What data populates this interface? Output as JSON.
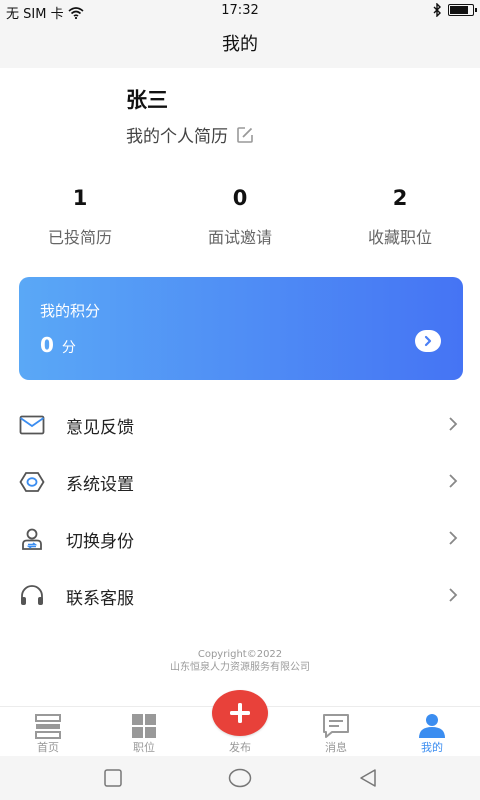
{
  "status_bar": {
    "carrier": "无 SIM 卡",
    "time": "17:32",
    "icons": [
      "wifi-icon",
      "bluetooth-icon",
      "battery-icon"
    ],
    "battery_level": 0.85
  },
  "header": {
    "title": "我的"
  },
  "profile": {
    "name": "张三",
    "resume_label": "我的个人简历",
    "resume_icon": "edit-icon"
  },
  "stats": [
    {
      "value": "1",
      "label": "已投简历"
    },
    {
      "value": "0",
      "label": "面试邀请"
    },
    {
      "value": "2",
      "label": "收藏职位"
    }
  ],
  "points": {
    "title": "我的积分",
    "value": "0",
    "unit": "分",
    "arrow_icon": "chevron-right-circle-icon"
  },
  "menu": [
    {
      "label": "意见反馈",
      "icon": "mail-icon"
    },
    {
      "label": "系统设置",
      "icon": "settings-hex-icon"
    },
    {
      "label": "切换身份",
      "icon": "user-switch-icon"
    },
    {
      "label": "联系客服",
      "icon": "headset-icon"
    }
  ],
  "footer": {
    "copyright": "Copyright©2022",
    "company": "山东恒泉人力资源服务有限公司"
  },
  "tab_bar": {
    "tabs": [
      {
        "label": "首页",
        "icon": "home-icon"
      },
      {
        "label": "职位",
        "icon": "grid-icon"
      },
      {
        "label": "发布",
        "icon": "plus-icon"
      },
      {
        "label": "消息",
        "icon": "message-icon"
      },
      {
        "label": "我的",
        "icon": "user-icon"
      }
    ],
    "active_index": 4
  },
  "colors": {
    "accent": "#3b8df0",
    "card_gradient_start": "#5aa8f6",
    "card_gradient_end": "#4574f4",
    "publish_button": "#e8413a"
  }
}
